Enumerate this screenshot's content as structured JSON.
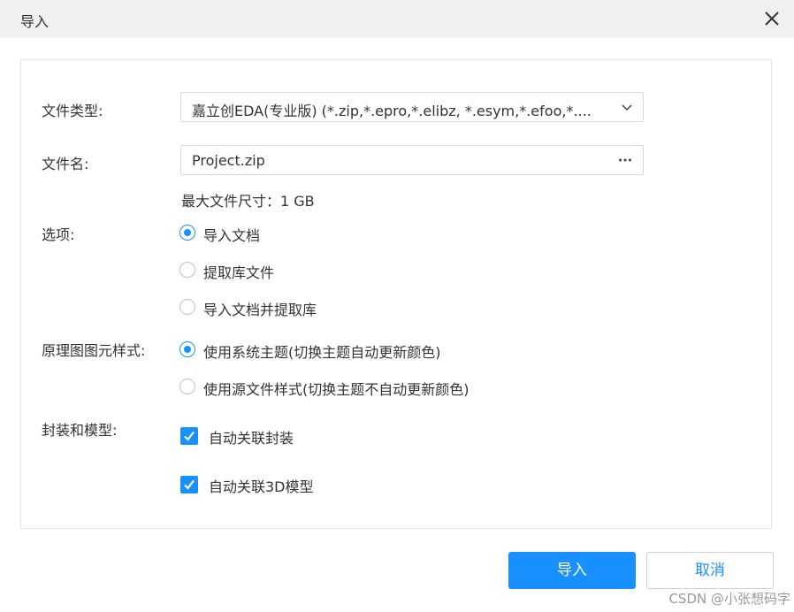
{
  "dialog": {
    "title": "导入"
  },
  "form": {
    "file_type_label": "文件类型:",
    "file_type_value": "嘉立创EDA(专业版) (*.zip,*.epro,*.elibz, *.esym,*.efoo,*....",
    "file_name_label": "文件名:",
    "file_name_value": "Project.zip",
    "file_size_hint": "最大文件尺寸：1 GB",
    "options_label": "选项:",
    "options": [
      {
        "label": "导入文档",
        "checked": true
      },
      {
        "label": "提取库文件",
        "checked": false
      },
      {
        "label": "导入文档并提取库",
        "checked": false
      }
    ],
    "style_label": "原理图图元样式:",
    "style_options": [
      {
        "label": "使用系统主题(切换主题自动更新颜色)",
        "checked": true
      },
      {
        "label": "使用源文件样式(切换主题不自动更新颜色)",
        "checked": false
      }
    ],
    "package_label": "封装和模型:",
    "package_checks": [
      {
        "label": "自动关联封装",
        "checked": true
      },
      {
        "label": "自动关联3D模型",
        "checked": true
      }
    ]
  },
  "buttons": {
    "import_label": "导入",
    "cancel_label": "取消"
  },
  "watermark": "CSDN @小张想码字",
  "colors": {
    "accent": "#1890ff",
    "titlebar": "#f0f0f0",
    "text": "#333333"
  },
  "icons": {
    "close": "close-icon",
    "dropdown": "chevron-down-icon",
    "browse": "more-horizontal-icon",
    "check": "check-icon"
  }
}
